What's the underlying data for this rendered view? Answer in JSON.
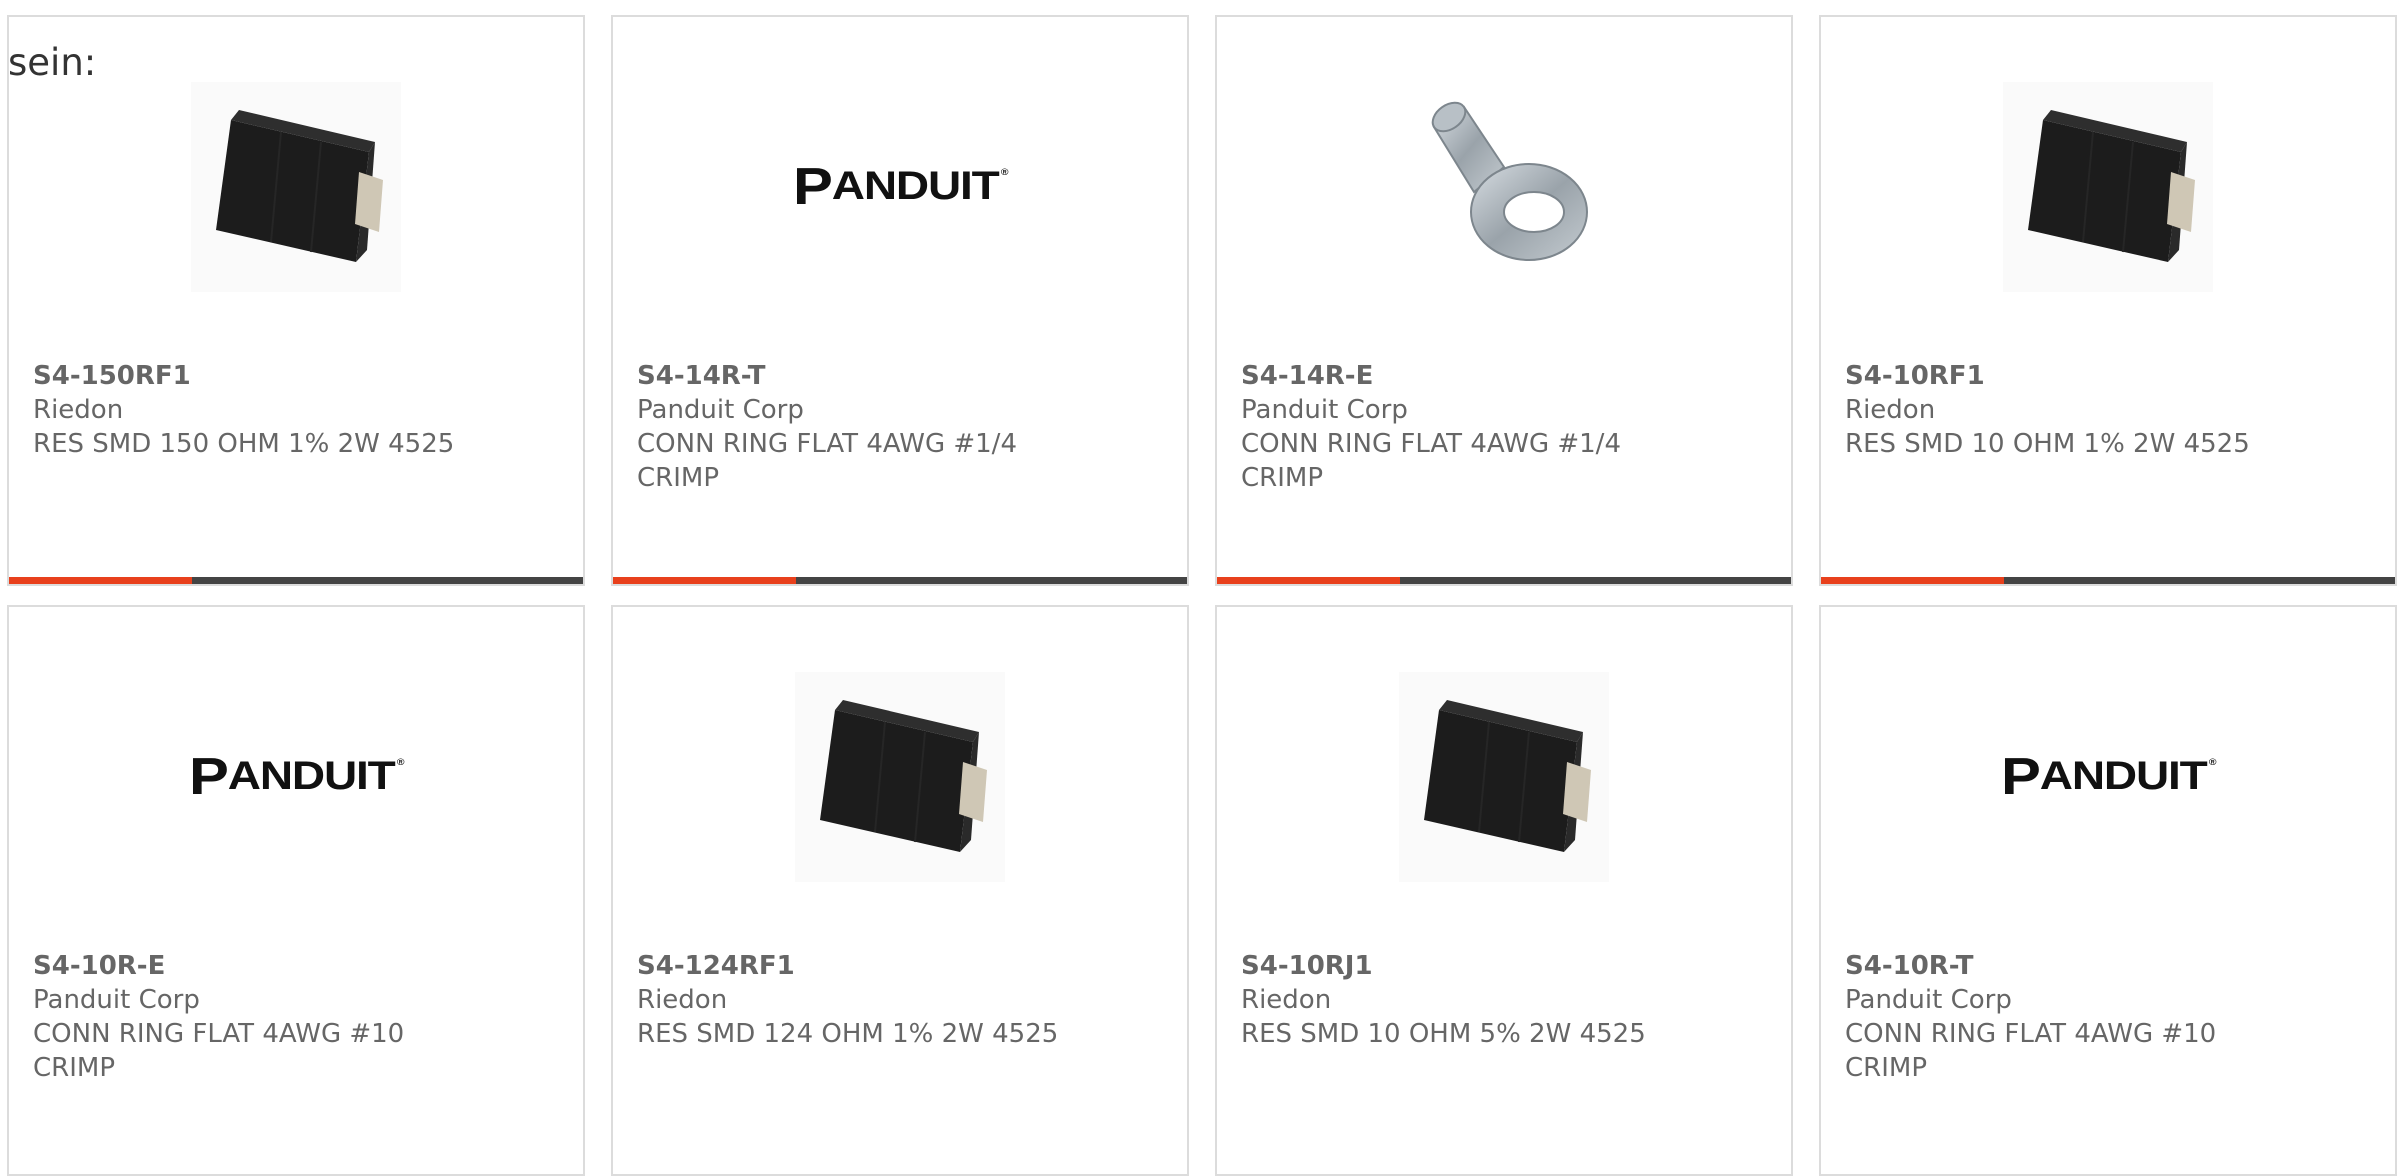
{
  "intro_text": "sein:",
  "colors": {
    "accent_bar": "#e8401c",
    "bar_dark": "#444444",
    "card_border": "#dcdcdc",
    "text": "#666666"
  },
  "products": [
    {
      "part_number": "S4-150RF1",
      "manufacturer": "Riedon",
      "description": "RES SMD 150 OHM 1% 2W 4525",
      "image_type": "resistor-smd-image"
    },
    {
      "part_number": "S4-14R-T",
      "manufacturer": "Panduit Corp",
      "description": "CONN RING FLAT 4AWG #1/4\nCRIMP",
      "image_type": "panduit-logo-image"
    },
    {
      "part_number": "S4-14R-E",
      "manufacturer": "Panduit Corp",
      "description": "CONN RING FLAT 4AWG #1/4\nCRIMP",
      "image_type": "ring-terminal-image"
    },
    {
      "part_number": "S4-10RF1",
      "manufacturer": "Riedon",
      "description": "RES SMD 10 OHM 1% 2W 4525",
      "image_type": "resistor-smd-image"
    },
    {
      "part_number": "S4-10R-E",
      "manufacturer": "Panduit Corp",
      "description": "CONN RING FLAT 4AWG #10\nCRIMP",
      "image_type": "panduit-logo-image"
    },
    {
      "part_number": "S4-124RF1",
      "manufacturer": "Riedon",
      "description": "RES SMD 124 OHM 1% 2W 4525",
      "image_type": "resistor-smd-image"
    },
    {
      "part_number": "S4-10RJ1",
      "manufacturer": "Riedon",
      "description": "RES SMD 10 OHM 5% 2W 4525",
      "image_type": "resistor-smd-image"
    },
    {
      "part_number": "S4-10R-T",
      "manufacturer": "Panduit Corp",
      "description": "CONN RING FLAT 4AWG #10\nCRIMP",
      "image_type": "panduit-logo-image"
    }
  ],
  "panduit_logo_text": "PANDUIT"
}
